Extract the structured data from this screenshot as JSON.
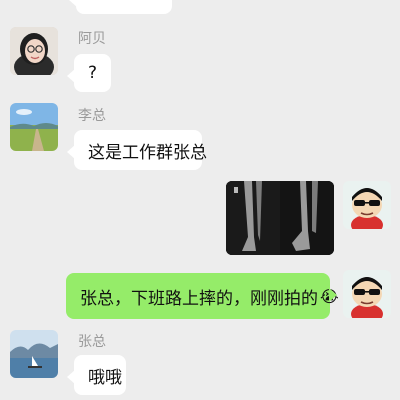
{
  "messages": [
    {
      "sender": "",
      "text": "",
      "direction": "incoming"
    },
    {
      "sender": "阿贝",
      "text": "?",
      "direction": "incoming"
    },
    {
      "sender": "李总",
      "text": "这是工作群张总",
      "direction": "incoming"
    },
    {
      "sender": "me",
      "text": "",
      "type": "image",
      "direction": "outgoing"
    },
    {
      "sender": "me",
      "text": "张总，下班路上摔的，刚刚拍的",
      "emoji": "😭",
      "direction": "outgoing"
    },
    {
      "sender": "张总",
      "text": "哦哦",
      "direction": "incoming"
    }
  ],
  "avatars": {
    "abei": "girl-with-glasses",
    "lizong": "landscape-road",
    "self": "cartoon-boy-sunglasses",
    "zhangzong": "lake-sailboat"
  },
  "colors": {
    "background": "#ededed",
    "incoming_bubble": "#ffffff",
    "outgoing_bubble": "#95ec69",
    "name_text": "#9a9a9a"
  }
}
